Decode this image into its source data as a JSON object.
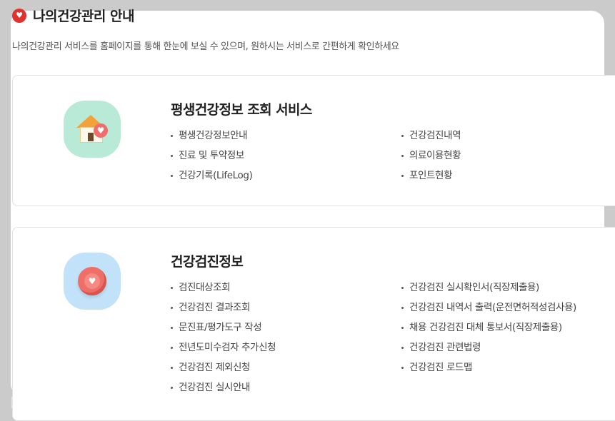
{
  "header": {
    "title": "나의건강관리 안내",
    "subtitle": "나의건강관리 서비스를 홈페이지를 통해 한눈에 보실 수 있으며, 원하시는 서비스로 간편하게 확인하세요"
  },
  "sections": [
    {
      "icon": "house-heart-icon",
      "title": "평생건강정보 조회 서비스",
      "left_items": [
        "평생건강정보안내",
        "진료 및 투약정보",
        "건강기록(LifeLog)"
      ],
      "right_items": [
        "건강검진내역",
        "의료이용현황",
        "포인트현황"
      ]
    },
    {
      "icon": "heart-bubble-icon",
      "title": "건강검진정보",
      "left_items": [
        "검진대상조회",
        "건강검진 결과조회",
        "문진표/평가도구 작성",
        "전년도미수검자 추가신청",
        "건강검진 제외신청",
        "건강검진 실시안내"
      ],
      "right_items": [
        "건강검진 실시확인서(직장제출용)",
        "건강검진 내역서 출력(운전면허적성검사용)",
        "채용 건강검진 대체 통보서(직장제출용)",
        "건강검진 관련법령",
        "건강검진 로드맵"
      ]
    }
  ],
  "colors": {
    "accent": "#e0322f",
    "mint": "#b9ead7",
    "sky": "#c2e2fa",
    "background": "#cbcbcb"
  }
}
